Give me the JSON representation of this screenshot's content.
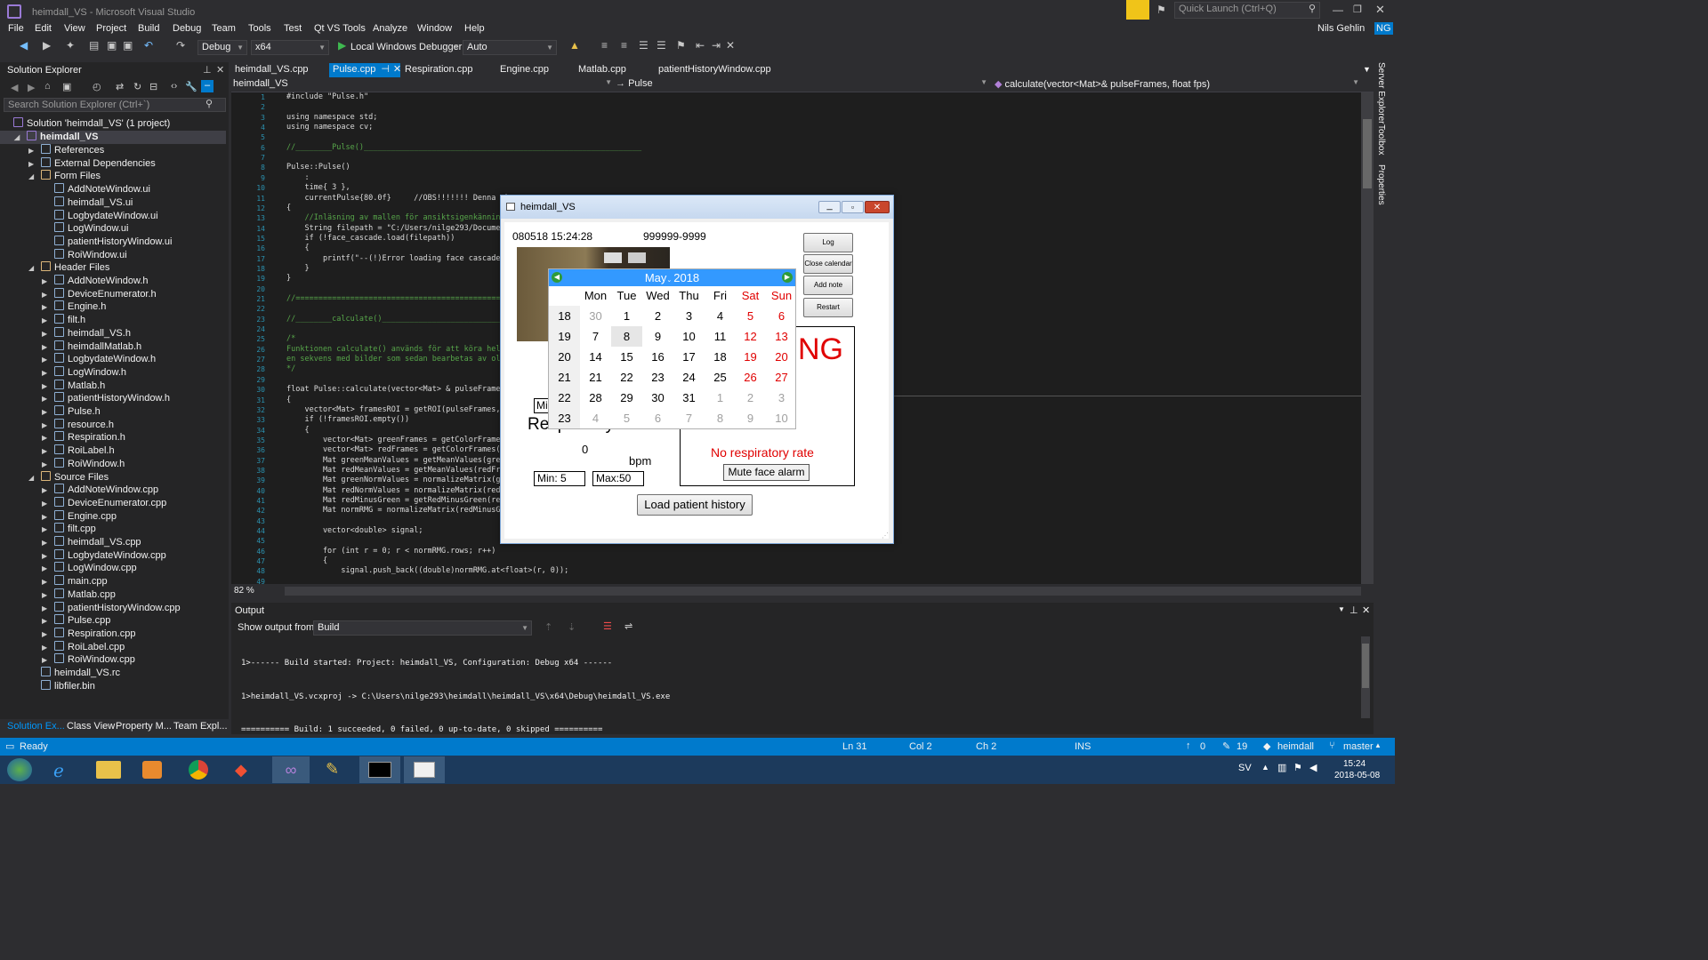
{
  "window": {
    "title": "heimdall_VS - Microsoft Visual Studio",
    "quick_launch": "Quick Launch (Ctrl+Q)"
  },
  "menu": [
    "File",
    "Edit",
    "View",
    "Project",
    "Build",
    "Debug",
    "Team",
    "Tools",
    "Test",
    "Qt VS Tools",
    "Analyze",
    "Window",
    "Help"
  ],
  "user": {
    "name": "Nils Gehlin",
    "initials": "NG"
  },
  "toolbar": {
    "config": "Debug",
    "platform": "x64",
    "debugger": "Local Windows Debugger",
    "auto": "Auto"
  },
  "solution_explorer": {
    "title": "Solution Explorer",
    "search": "Search Solution Explorer (Ctrl+`)",
    "solution": "Solution 'heimdall_VS' (1 project)",
    "project": "heimdall_VS",
    "items": [
      "References",
      "External Dependencies",
      "Form Files",
      "AddNoteWindow.ui",
      "heimdall_VS.ui",
      "LogbydateWindow.ui",
      "LogWindow.ui",
      "patientHistoryWindow.ui",
      "RoiWindow.ui",
      "Header Files",
      "AddNoteWindow.h",
      "DeviceEnumerator.h",
      "Engine.h",
      "filt.h",
      "heimdall_VS.h",
      "heimdallMatlab.h",
      "LogbydateWindow.h",
      "LogWindow.h",
      "Matlab.h",
      "patientHistoryWindow.h",
      "Pulse.h",
      "resource.h",
      "Respiration.h",
      "RoiLabel.h",
      "RoiWindow.h",
      "Source Files",
      "AddNoteWindow.cpp",
      "DeviceEnumerator.cpp",
      "Engine.cpp",
      "filt.cpp",
      "heimdall_VS.cpp",
      "LogbydateWindow.cpp",
      "LogWindow.cpp",
      "main.cpp",
      "Matlab.cpp",
      "patientHistoryWindow.cpp",
      "Pulse.cpp",
      "Respiration.cpp",
      "RoiLabel.cpp",
      "RoiWindow.cpp",
      "heimdall_VS.rc",
      "libfiler.bin"
    ],
    "bottom_tabs": [
      "Solution Ex...",
      "Class View",
      "Property M...",
      "Team Expl..."
    ]
  },
  "tabs": [
    "heimdall_VS.cpp",
    "Pulse.cpp",
    "Respiration.cpp",
    "Engine.cpp",
    "Matlab.cpp",
    "patientHistoryWindow.cpp"
  ],
  "nav": {
    "project": "heimdall_VS",
    "scope": "Pulse",
    "member": "calculate(vector<Mat>& pulseFrames, float fps)"
  },
  "code_lines": [
    "#include \"Pulse.h\"",
    "",
    "using namespace std;",
    "using namespace cv;",
    "",
    "//________Pulse()_____________________________________________________________",
    "",
    "Pulse::Pulse()",
    "    :",
    "    time{ 3 },",
    "    currentPulse{80.0f}     //OBS!!!!!!! Denna ska",
    "{",
    "    //Inläsning av mallen för ansiktsigenkänning",
    "    String filepath = \"C:/Users/nilge293/Documents",
    "    if (!face_cascade.load(filepath))",
    "    {",
    "        printf(\"--(!)Error loading face cascade\\n\"",
    "    }",
    "}",
    "",
    "//==============================================================================",
    "",
    "//________calculate()__________________________________________________________",
    "",
    "/*",
    "Funktionen calculate() används för att köra hela p",
    "en sekvens med bilder som sedan bearbetas av olika",
    "*/",
    "",
    "float Pulse::calculate(vector<Mat> & pulseFrames,",
    "{",
    "    vector<Mat> framesROI = getROI(pulseFrames, fp",
    "    if (!framesROI.empty())",
    "    {",
    "        vector<Mat> greenFrames = getColorFrames(f",
    "        vector<Mat> redFrames = getColorFrames(fra",
    "        Mat greenMeanValues = getMeanValues(greenF",
    "        Mat redMeanValues = getMeanValues(redFrame",
    "        Mat greenNormValues = normalizeMatrix(gree",
    "        Mat redNormValues = normalizeMatrix(redMea",
    "        Mat redMinusGreen = getRedMinusGreen(redNo",
    "        Mat normRMG = normalizeMatrix(redMinusGree",
    "",
    "        vector<double> signal;",
    "",
    "        for (int r = 0; r < normRMG.rows; r++)",
    "        {",
    "            signal.push_back((double)normRMG.at<float>(r, 0));",
    "        "
  ],
  "zoom": "82 %",
  "output": {
    "title": "Output",
    "show_from": "Show output from:",
    "source": "Build",
    "lines": [
      "1>------ Build started: Project: heimdall_VS, Configuration: Debug x64 ------",
      "1>heimdall_VS.vcxproj -> C:\\Users\\nilge293\\heimdall\\heimdall_VS\\x64\\Debug\\heimdall_VS.exe",
      "========== Build: 1 succeeded, 0 failed, 0 up-to-date, 0 skipped =========="
    ]
  },
  "status": {
    "ready": "Ready",
    "ln": "Ln 31",
    "col": "Col 2",
    "ch": "Ch 2",
    "ins": "INS",
    "up": "0",
    "edits": "19",
    "repo": "heimdall",
    "branch": "master"
  },
  "app": {
    "title": "heimdall_VS",
    "datetime": "080518 15:24:28",
    "patient_id": "999999-9999",
    "buttons": [
      "Log",
      "Close calendar",
      "Add note",
      "Restart"
    ],
    "alarm_partial": "NG",
    "no_resp": "No respiratory rate",
    "mute": "Mute face alarm",
    "resp_label": "Respiratory rate:",
    "resp_value": "0",
    "bpm": "bpm",
    "min": "Min: 5",
    "max": "Max:50",
    "mi": "Mi",
    "load_history": "Load patient history",
    "calendar": {
      "month": "May",
      "year": "2018",
      "days": [
        "Mon",
        "Tue",
        "Wed",
        "Thu",
        "Fri",
        "Sat",
        "Sun"
      ],
      "weeks": [
        [
          "18",
          "30",
          "1",
          "2",
          "3",
          "4",
          "5",
          "6"
        ],
        [
          "19",
          "7",
          "8",
          "9",
          "10",
          "11",
          "12",
          "13"
        ],
        [
          "20",
          "14",
          "15",
          "16",
          "17",
          "18",
          "19",
          "20"
        ],
        [
          "21",
          "21",
          "22",
          "23",
          "24",
          "25",
          "26",
          "27"
        ],
        [
          "22",
          "28",
          "29",
          "30",
          "31",
          "1",
          "2",
          "3"
        ],
        [
          "23",
          "4",
          "5",
          "6",
          "7",
          "8",
          "9",
          "10"
        ]
      ]
    }
  },
  "taskbar": {
    "lang": "SV",
    "time": "15:24",
    "date": "2018-05-08"
  }
}
